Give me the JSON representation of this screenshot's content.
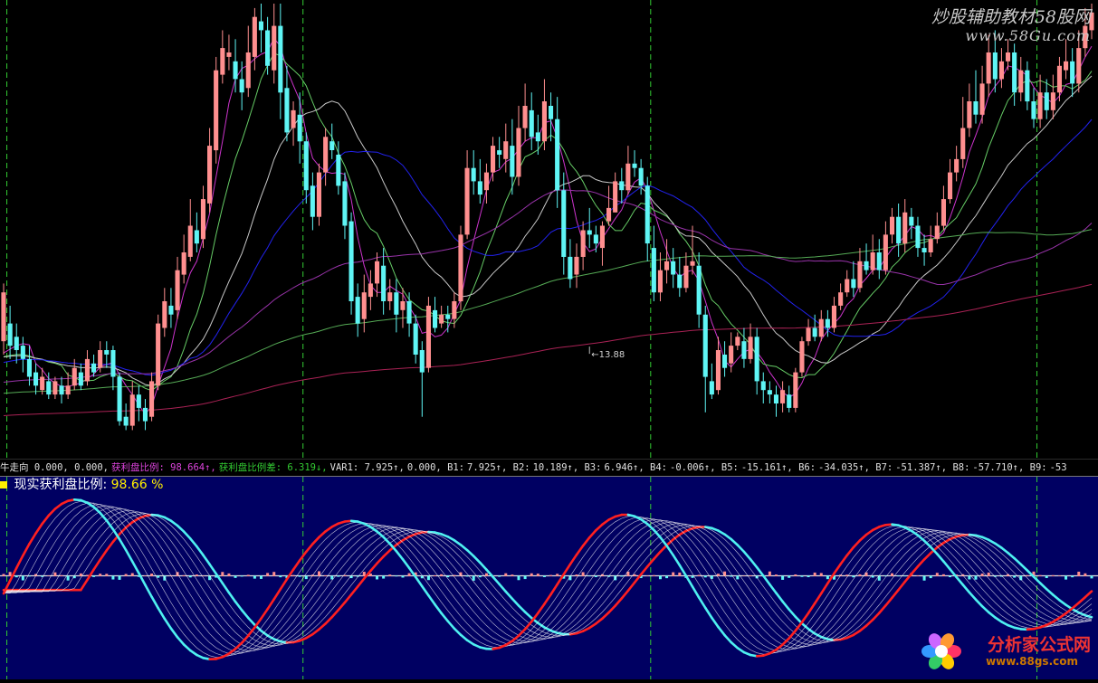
{
  "watermarks": {
    "site_top_name": "炒股辅助教材58股网",
    "site_top_url": "www.58Gu.com",
    "site_bottom_name": "分析家公式网",
    "site_bottom_url": "www.88gs.com"
  },
  "colors": {
    "background": "#000000",
    "indicator_bg": "#000062",
    "up": "#ff8f8f",
    "down": "#5ff5f5",
    "gridline_vertical": "#33cc33",
    "ma5": "#cc33cc",
    "ma10": "#66cc66",
    "ma20": "#c8c8c8",
    "ma30": "#2222ee",
    "ma60": "#9933aa",
    "ma120": "#55aa55",
    "ma250": "#aa2255",
    "osc_red": "#ff2020",
    "osc_cyan": "#4ff0f0",
    "osc_fan": "#ffffff"
  },
  "indicator_status": {
    "items": [
      {
        "label": "牛走向",
        "value": "0.000, 0.000,",
        "color": "#e0e0e0"
      },
      {
        "label": "获利盘比例:",
        "value": "98.664↑,",
        "color": "#dd44dd"
      },
      {
        "label": "获利盘比例差:",
        "value": "6.319↓,",
        "color": "#33cc33"
      },
      {
        "label": "VAR1:",
        "value": "7.925↑,",
        "color": "#e0e0e0"
      },
      {
        "label": "",
        "value": "0.000, B1:",
        "color": "#e0e0e0"
      },
      {
        "label": "",
        "value": "7.925↑, B2:",
        "color": "#e0e0e0"
      },
      {
        "label": "",
        "value": "10.189↑, B3:",
        "color": "#e0e0e0"
      },
      {
        "label": "",
        "value": "6.946↑, B4:",
        "color": "#e0e0e0"
      },
      {
        "label": "",
        "value": "-0.006↑, B5:",
        "color": "#e0e0e0"
      },
      {
        "label": "",
        "value": "-15.161↑, B6:",
        "color": "#e0e0e0"
      },
      {
        "label": "",
        "value": "-34.035↑, B7:",
        "color": "#e0e0e0"
      },
      {
        "label": "",
        "value": "-51.387↑, B8:",
        "color": "#e0e0e0"
      },
      {
        "label": "",
        "value": "-57.710↑, B9:",
        "color": "#e0e0e0"
      },
      {
        "label": "",
        "value": "-53",
        "color": "#e0e0e0"
      }
    ]
  },
  "indicator_title": {
    "label": "现实获利盘比例:",
    "value": "98.66 %"
  },
  "chart_data": [
    {
      "type": "candlestick",
      "panel": "price",
      "title": "",
      "ylim": [
        11.5,
        21.6
      ],
      "annotation": {
        "text": "←13.88",
        "index": 91,
        "price": 13.88
      },
      "candles": [
        [
          14.0,
          15.1,
          15.3,
          13.7
        ],
        [
          14.4,
          13.9,
          14.8,
          13.6
        ],
        [
          14.1,
          13.8,
          14.4,
          13.5
        ],
        [
          13.9,
          13.6,
          14.1,
          13.3
        ],
        [
          13.6,
          13.2,
          13.9,
          13.0
        ],
        [
          13.3,
          13.0,
          13.5,
          12.8
        ],
        [
          12.9,
          13.2,
          13.4,
          12.8
        ],
        [
          13.1,
          12.8,
          13.3,
          12.7
        ],
        [
          12.8,
          13.1,
          13.2,
          12.7
        ],
        [
          13.0,
          12.8,
          13.2,
          12.6
        ],
        [
          12.8,
          13.0,
          13.3,
          12.7
        ],
        [
          13.0,
          13.4,
          13.6,
          12.9
        ],
        [
          13.3,
          13.0,
          13.5,
          12.9
        ],
        [
          13.1,
          13.6,
          13.8,
          13.0
        ],
        [
          13.5,
          13.3,
          13.7,
          13.2
        ],
        [
          13.4,
          13.8,
          14.0,
          13.3
        ],
        [
          13.8,
          13.7,
          14.0,
          13.4
        ],
        [
          13.8,
          13.2,
          13.9,
          12.9
        ],
        [
          13.2,
          12.2,
          13.3,
          12.1
        ],
        [
          12.3,
          12.1,
          12.6,
          12.0
        ],
        [
          12.1,
          12.8,
          13.1,
          12.0
        ],
        [
          12.8,
          12.5,
          13.0,
          12.2
        ],
        [
          12.5,
          12.2,
          12.7,
          12.0
        ],
        [
          12.3,
          13.1,
          13.3,
          12.2
        ],
        [
          13.0,
          14.4,
          14.6,
          12.9
        ],
        [
          14.3,
          14.9,
          15.2,
          14.1
        ],
        [
          14.8,
          14.6,
          15.2,
          14.3
        ],
        [
          14.7,
          15.6,
          15.9,
          14.5
        ],
        [
          15.5,
          16.0,
          16.4,
          15.3
        ],
        [
          15.9,
          16.6,
          17.2,
          15.8
        ],
        [
          16.5,
          16.2,
          16.9,
          16.0
        ],
        [
          16.3,
          17.2,
          17.5,
          16.1
        ],
        [
          17.1,
          18.4,
          18.8,
          16.9
        ],
        [
          18.3,
          20.1,
          20.4,
          18.0
        ],
        [
          20.0,
          20.6,
          21.0,
          19.8
        ],
        [
          20.4,
          20.5,
          20.9,
          20.1
        ],
        [
          20.3,
          19.9,
          20.8,
          19.6
        ],
        [
          19.9,
          19.6,
          20.3,
          19.2
        ],
        [
          19.7,
          20.5,
          21.1,
          19.5
        ],
        [
          20.4,
          21.3,
          21.5,
          20.1
        ],
        [
          21.2,
          21.0,
          21.6,
          20.5
        ],
        [
          21.0,
          20.2,
          21.3,
          20.0
        ],
        [
          20.1,
          21.1,
          21.6,
          19.8
        ],
        [
          21.1,
          19.6,
          21.6,
          19.0
        ],
        [
          19.7,
          18.7,
          20.2,
          18.5
        ],
        [
          18.8,
          19.2,
          19.4,
          18.4
        ],
        [
          19.1,
          18.5,
          19.6,
          18.0
        ],
        [
          18.5,
          17.4,
          18.7,
          17.1
        ],
        [
          17.5,
          16.8,
          17.8,
          16.5
        ],
        [
          16.8,
          17.8,
          18.0,
          16.6
        ],
        [
          17.8,
          18.6,
          18.8,
          17.5
        ],
        [
          18.5,
          18.3,
          18.9,
          18.1
        ],
        [
          18.2,
          17.5,
          18.5,
          17.3
        ],
        [
          17.6,
          16.6,
          17.8,
          16.3
        ],
        [
          16.7,
          14.9,
          16.9,
          14.6
        ],
        [
          15.0,
          14.4,
          15.3,
          14.1
        ],
        [
          14.5,
          15.1,
          15.5,
          14.2
        ],
        [
          15.0,
          15.3,
          15.6,
          14.7
        ],
        [
          15.3,
          15.8,
          16.0,
          15.0
        ],
        [
          15.7,
          14.9,
          16.1,
          14.6
        ],
        [
          14.9,
          15.1,
          15.4,
          14.7
        ],
        [
          15.1,
          14.6,
          15.4,
          14.2
        ],
        [
          14.7,
          14.9,
          15.2,
          14.3
        ],
        [
          14.9,
          14.4,
          15.1,
          14.1
        ],
        [
          14.4,
          13.7,
          14.6,
          13.5
        ],
        [
          13.8,
          13.3,
          14.0,
          12.3
        ],
        [
          13.4,
          14.8,
          15.0,
          13.3
        ],
        [
          14.7,
          14.3,
          15.0,
          14.2
        ],
        [
          14.4,
          14.6,
          14.8,
          14.3
        ],
        [
          14.6,
          14.5,
          14.8,
          14.2
        ],
        [
          14.5,
          14.9,
          15.1,
          14.3
        ],
        [
          14.9,
          16.4,
          16.6,
          14.7
        ],
        [
          16.4,
          17.9,
          18.3,
          16.3
        ],
        [
          17.9,
          17.6,
          18.3,
          17.3
        ],
        [
          17.6,
          17.3,
          18.1,
          17.1
        ],
        [
          17.4,
          17.8,
          18.0,
          17.1
        ],
        [
          17.8,
          18.4,
          18.6,
          17.6
        ],
        [
          18.3,
          18.2,
          18.6,
          17.9
        ],
        [
          18.1,
          18.5,
          18.9,
          17.8
        ],
        [
          18.4,
          17.7,
          19.0,
          17.3
        ],
        [
          17.7,
          18.8,
          19.3,
          17.5
        ],
        [
          18.8,
          19.3,
          19.8,
          18.5
        ],
        [
          19.2,
          18.6,
          19.6,
          18.3
        ],
        [
          18.7,
          18.5,
          19.1,
          18.2
        ],
        [
          18.5,
          19.4,
          19.9,
          18.3
        ],
        [
          19.3,
          19.0,
          19.6,
          18.5
        ],
        [
          19.0,
          17.4,
          19.5,
          17.0
        ],
        [
          17.4,
          15.9,
          17.8,
          15.5
        ],
        [
          15.9,
          15.4,
          16.3,
          15.2
        ],
        [
          15.5,
          15.9,
          16.2,
          15.2
        ],
        [
          15.9,
          16.5,
          16.7,
          15.6
        ],
        [
          16.5,
          16.4,
          17.0,
          16.1
        ],
        [
          16.4,
          16.2,
          16.6,
          16.0
        ],
        [
          16.1,
          16.6,
          16.7,
          15.7
        ],
        [
          16.7,
          17.0,
          17.5,
          16.6
        ],
        [
          16.9,
          17.6,
          17.8,
          16.9
        ],
        [
          17.6,
          17.4,
          17.9,
          17.1
        ],
        [
          17.4,
          18.0,
          18.4,
          17.3
        ],
        [
          18.0,
          17.9,
          18.3,
          17.7
        ],
        [
          17.9,
          17.5,
          18.1,
          17.3
        ],
        [
          17.5,
          16.2,
          17.7,
          15.8
        ],
        [
          16.1,
          15.1,
          16.6,
          14.9
        ],
        [
          15.1,
          15.6,
          16.0,
          14.9
        ],
        [
          15.6,
          15.8,
          16.3,
          15.3
        ],
        [
          15.8,
          15.5,
          16.1,
          15.2
        ],
        [
          15.5,
          15.2,
          15.9,
          15.0
        ],
        [
          15.2,
          15.7,
          16.0,
          15.1
        ],
        [
          15.7,
          15.8,
          16.6,
          15.5
        ],
        [
          15.7,
          14.6,
          16.0,
          14.3
        ],
        [
          14.6,
          13.2,
          14.8,
          12.4
        ],
        [
          13.1,
          12.8,
          13.5,
          12.7
        ],
        [
          12.9,
          13.8,
          14.1,
          12.8
        ],
        [
          13.7,
          13.4,
          14.0,
          13.2
        ],
        [
          13.5,
          13.9,
          14.2,
          13.3
        ],
        [
          13.9,
          14.1,
          14.2,
          13.8
        ],
        [
          14.0,
          13.6,
          14.3,
          13.4
        ],
        [
          13.6,
          14.1,
          14.4,
          13.5
        ],
        [
          14.1,
          13.1,
          14.3,
          12.8
        ],
        [
          13.1,
          12.9,
          13.3,
          12.6
        ],
        [
          12.9,
          12.8,
          13.1,
          12.6
        ],
        [
          12.8,
          12.6,
          13.0,
          12.3
        ],
        [
          12.6,
          12.9,
          13.1,
          12.4
        ],
        [
          12.8,
          12.5,
          13.0,
          12.4
        ],
        [
          12.5,
          13.3,
          13.4,
          12.4
        ],
        [
          13.3,
          14.0,
          14.1,
          13.2
        ],
        [
          14.0,
          14.3,
          14.5,
          13.9
        ],
        [
          14.3,
          14.1,
          14.6,
          14.0
        ],
        [
          14.1,
          14.5,
          14.7,
          14.0
        ],
        [
          14.5,
          14.3,
          14.7,
          14.1
        ],
        [
          14.3,
          14.8,
          15.0,
          14.2
        ],
        [
          14.8,
          15.1,
          15.3,
          14.7
        ],
        [
          15.1,
          15.4,
          15.6,
          15.0
        ],
        [
          15.4,
          15.2,
          15.8,
          15.0
        ],
        [
          15.2,
          15.8,
          16.1,
          15.1
        ],
        [
          15.8,
          15.6,
          16.2,
          15.5
        ],
        [
          15.6,
          16.0,
          16.4,
          15.5
        ],
        [
          16.0,
          15.6,
          16.3,
          15.4
        ],
        [
          15.6,
          16.4,
          16.7,
          15.5
        ],
        [
          16.4,
          16.8,
          17.0,
          16.2
        ],
        [
          16.8,
          16.2,
          17.1,
          15.9
        ],
        [
          16.2,
          16.9,
          17.2,
          16.0
        ],
        [
          16.8,
          16.6,
          17.0,
          16.3
        ],
        [
          16.6,
          16.1,
          16.8,
          15.9
        ],
        [
          16.1,
          16.0,
          16.4,
          15.7
        ],
        [
          16.0,
          16.3,
          16.6,
          15.9
        ],
        [
          16.3,
          16.6,
          16.9,
          16.2
        ],
        [
          16.6,
          17.2,
          17.5,
          16.5
        ],
        [
          17.2,
          17.8,
          18.1,
          17.1
        ],
        [
          17.8,
          18.1,
          18.4,
          17.6
        ],
        [
          18.1,
          18.8,
          19.5,
          17.9
        ],
        [
          18.8,
          19.4,
          19.8,
          18.6
        ],
        [
          19.4,
          19.1,
          20.1,
          18.9
        ],
        [
          19.1,
          19.8,
          20.2,
          18.9
        ],
        [
          19.8,
          20.5,
          20.9,
          19.5
        ],
        [
          20.5,
          19.9,
          21.0,
          19.6
        ],
        [
          19.9,
          20.3,
          20.6,
          19.7
        ],
        [
          20.3,
          20.5,
          20.8,
          20.1
        ],
        [
          20.5,
          19.6,
          20.7,
          19.3
        ],
        [
          19.6,
          20.1,
          20.4,
          19.4
        ],
        [
          20.1,
          19.4,
          20.3,
          19.2
        ],
        [
          19.4,
          19.0,
          19.7,
          18.8
        ],
        [
          19.0,
          19.6,
          20.0,
          18.8
        ],
        [
          19.6,
          19.2,
          19.9,
          19.0
        ],
        [
          19.2,
          19.6,
          20.0,
          19.0
        ],
        [
          19.6,
          20.2,
          20.4,
          19.4
        ],
        [
          20.1,
          20.3,
          20.8,
          19.9
        ],
        [
          20.3,
          19.8,
          20.6,
          19.5
        ],
        [
          19.8,
          20.6,
          21.0,
          19.6
        ],
        [
          20.6,
          21.1,
          21.5,
          20.4
        ],
        [
          21.0,
          21.4,
          21.6,
          20.8
        ]
      ],
      "moving_averages": [
        {
          "period": 5,
          "color": "#cc33cc"
        },
        {
          "period": 10,
          "color": "#66cc66"
        },
        {
          "period": 20,
          "color": "#c8c8c8"
        },
        {
          "period": 30,
          "color": "#2222ee"
        },
        {
          "period": 60,
          "color": "#9933aa"
        },
        {
          "period": 120,
          "color": "#55aa55"
        },
        {
          "period": 250,
          "color": "#aa2255"
        }
      ],
      "vertical_markers": [
        0.5,
        46.5,
        100.5,
        160.5,
        177.5
      ]
    },
    {
      "type": "line",
      "panel": "indicator",
      "title": "",
      "ylim": [
        -110,
        105
      ],
      "zero_line": true,
      "lines": 11,
      "series_note": "oscillator fan B1..B9; red where rising, cyan where falling"
    }
  ]
}
